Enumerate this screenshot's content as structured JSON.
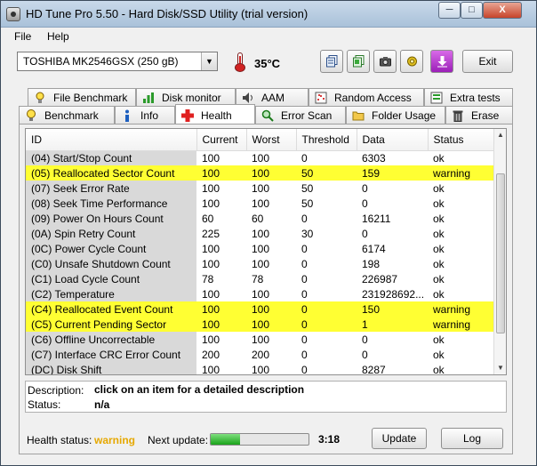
{
  "window": {
    "title": "HD Tune Pro 5.50 - Hard Disk/SSD Utility (trial version)",
    "minimize_label": "─",
    "maximize_label": "□",
    "close_label": "X"
  },
  "menu": [
    "File",
    "Help"
  ],
  "toolbar": {
    "drive": "TOSHIBA MK2546GSX (250 gB)",
    "temperature": "35°C",
    "exit_label": "Exit",
    "icons": [
      "copy-text-icon",
      "copy-info-icon",
      "screenshot-icon",
      "options-icon",
      "save-icon"
    ]
  },
  "tabs_top": [
    {
      "label": "File Benchmark",
      "icon": "file-benchmark-icon"
    },
    {
      "label": "Disk monitor",
      "icon": "disk-monitor-icon"
    },
    {
      "label": "AAM",
      "icon": "speaker-icon"
    },
    {
      "label": "Random Access",
      "icon": "random-access-icon"
    },
    {
      "label": "Extra tests",
      "icon": "extra-tests-icon"
    }
  ],
  "tabs_bottom": [
    {
      "label": "Benchmark",
      "icon": "lightbulb-icon"
    },
    {
      "label": "Info",
      "icon": "info-icon"
    },
    {
      "label": "Health",
      "icon": "health-cross-icon",
      "active": true
    },
    {
      "label": "Error Scan",
      "icon": "magnifier-icon"
    },
    {
      "label": "Folder Usage",
      "icon": "folder-icon"
    },
    {
      "label": "Erase",
      "icon": "trash-icon"
    }
  ],
  "table": {
    "columns": [
      "ID",
      "Current",
      "Worst",
      "Threshold",
      "Data",
      "Status"
    ],
    "rows": [
      {
        "cells": [
          "(04) Start/Stop Count",
          "100",
          "100",
          "0",
          "6303",
          "ok"
        ],
        "warning": false
      },
      {
        "cells": [
          "(05) Reallocated Sector Count",
          "100",
          "100",
          "50",
          "159",
          "warning"
        ],
        "warning": true
      },
      {
        "cells": [
          "(07) Seek Error Rate",
          "100",
          "100",
          "50",
          "0",
          "ok"
        ],
        "warning": false
      },
      {
        "cells": [
          "(08) Seek Time Performance",
          "100",
          "100",
          "50",
          "0",
          "ok"
        ],
        "warning": false
      },
      {
        "cells": [
          "(09) Power On Hours Count",
          "60",
          "60",
          "0",
          "16211",
          "ok"
        ],
        "warning": false
      },
      {
        "cells": [
          "(0A) Spin Retry Count",
          "225",
          "100",
          "30",
          "0",
          "ok"
        ],
        "warning": false
      },
      {
        "cells": [
          "(0C) Power Cycle Count",
          "100",
          "100",
          "0",
          "6174",
          "ok"
        ],
        "warning": false
      },
      {
        "cells": [
          "(C0) Unsafe Shutdown Count",
          "100",
          "100",
          "0",
          "198",
          "ok"
        ],
        "warning": false
      },
      {
        "cells": [
          "(C1) Load Cycle Count",
          "78",
          "78",
          "0",
          "226987",
          "ok"
        ],
        "warning": false
      },
      {
        "cells": [
          "(C2) Temperature",
          "100",
          "100",
          "0",
          "231928692...",
          "ok"
        ],
        "warning": false
      },
      {
        "cells": [
          "(C4) Reallocated Event Count",
          "100",
          "100",
          "0",
          "150",
          "warning"
        ],
        "warning": true
      },
      {
        "cells": [
          "(C5) Current Pending Sector",
          "100",
          "100",
          "0",
          "1",
          "warning"
        ],
        "warning": true
      },
      {
        "cells": [
          "(C6) Offline Uncorrectable",
          "100",
          "100",
          "0",
          "0",
          "ok"
        ],
        "warning": false
      },
      {
        "cells": [
          "(C7) Interface CRC Error Count",
          "200",
          "200",
          "0",
          "0",
          "ok"
        ],
        "warning": false
      },
      {
        "cells": [
          "(DC) Disk Shift",
          "100",
          "100",
          "0",
          "8287",
          "ok"
        ],
        "warning": false
      }
    ]
  },
  "description": {
    "label": "Description:",
    "value": "click on an item for a detailed description",
    "status_label": "Status:",
    "status_value": "n/a"
  },
  "footer": {
    "health_label": "Health status:",
    "health_value": "warning",
    "next_update_label": "Next update:",
    "progress_fraction": 0.3,
    "countdown": "3:18",
    "update_label": "Update",
    "log_label": "Log"
  },
  "colors": {
    "warning_row": "#ffff33",
    "health_warning_text": "#e6a800",
    "progress_fill": "#1aa31a"
  }
}
